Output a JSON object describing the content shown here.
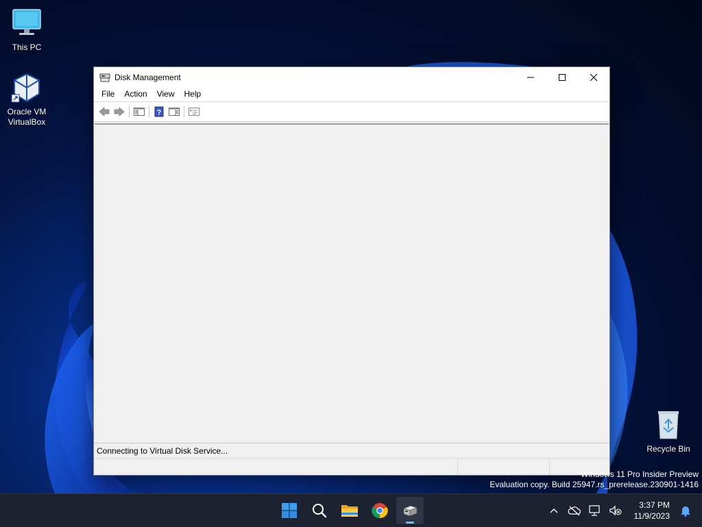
{
  "desktop": {
    "icons": [
      {
        "label_lines": [
          "This PC"
        ]
      },
      {
        "label_lines": [
          "Oracle VM",
          "VirtualBox"
        ]
      },
      {
        "label_lines": [
          "Recycle Bin"
        ]
      }
    ]
  },
  "window": {
    "title": "Disk Management",
    "menu": [
      "File",
      "Action",
      "View",
      "Help"
    ],
    "toolbar_icons": [
      "back-arrow-icon",
      "forward-arrow-icon",
      "show-hide-console-tree-icon",
      "help-icon",
      "show-hide-action-pane-icon",
      "properties-icon"
    ],
    "status_text": "Connecting to Virtual Disk Service..."
  },
  "watermark": {
    "line1": "Windows 11 Pro Insider Preview",
    "line2": "Evaluation copy. Build 25947.rs_prerelease.230901-1416"
  },
  "taskbar": {
    "apps": [
      "start-icon",
      "search-icon",
      "file-explorer-icon",
      "chrome-icon",
      "disk-management-icon"
    ],
    "active_app": "disk-management-icon",
    "tray_icons": [
      "show-hidden-icons-chevron",
      "onedrive-offline-icon",
      "network-icon",
      "volume-muted-icon"
    ],
    "time": "3:37 PM",
    "date": "11/9/2023"
  },
  "colors": {
    "accent": "#0a64d6",
    "taskbar": "#1c2230",
    "window_bg": "#f0f0f0"
  }
}
